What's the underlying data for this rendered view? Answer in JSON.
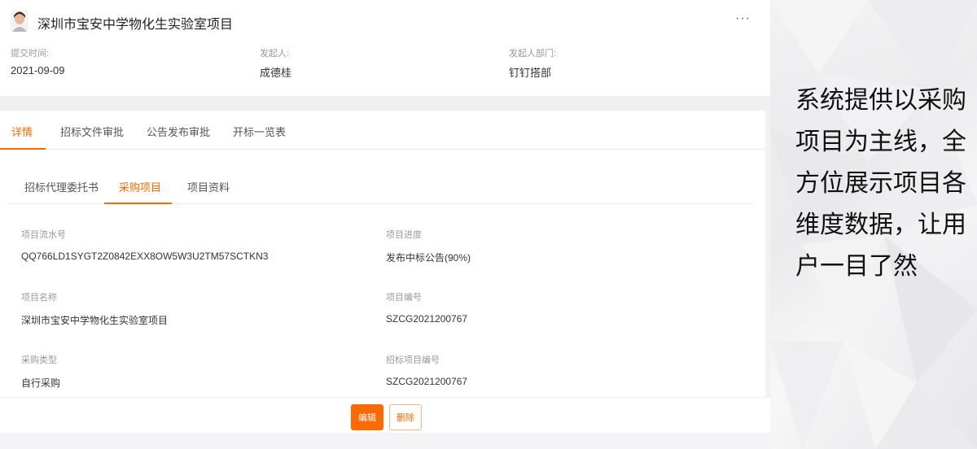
{
  "header": {
    "title": "深圳市宝安中学物化生实验室项目",
    "more_label": "···",
    "meta": [
      {
        "label": "提交时间:",
        "value": "2021-09-09"
      },
      {
        "label": "发起人:",
        "value": "成德桂"
      },
      {
        "label": "发起人部门:",
        "value": "钉钉搭部"
      }
    ]
  },
  "tabs": [
    "详情",
    "招标文件审批",
    "公告发布审批",
    "开标一览表"
  ],
  "active_tab": "详情",
  "subtabs": [
    "招标代理委托书",
    "采购项目",
    "项目资料"
  ],
  "active_subtab": "采购项目",
  "fields": [
    {
      "label": "项目流水号",
      "value": "QQ766LD1SYGT2Z0842EXX8OW5W3U2TM57SCTKN3"
    },
    {
      "label": "项目进度",
      "value": "发布中标公告(90%)"
    },
    {
      "label": "项目名称",
      "value": "深圳市宝安中学物化生实验室项目"
    },
    {
      "label": "项目编号",
      "value": "SZCG2021200767"
    },
    {
      "label": "采购类型",
      "value": "自行采购"
    },
    {
      "label": "招标项目编号",
      "value": "SZCG2021200767"
    }
  ],
  "actions": {
    "edit_label": "编辑",
    "delete_label": "删除"
  },
  "slogan": [
    "系统提供以采购",
    "项目为主线，全",
    "方位展示项目各",
    "维度数据，让用",
    "户一目了然"
  ],
  "colors": {
    "accent": "#ff6a00",
    "background": "#f4f4f6"
  }
}
